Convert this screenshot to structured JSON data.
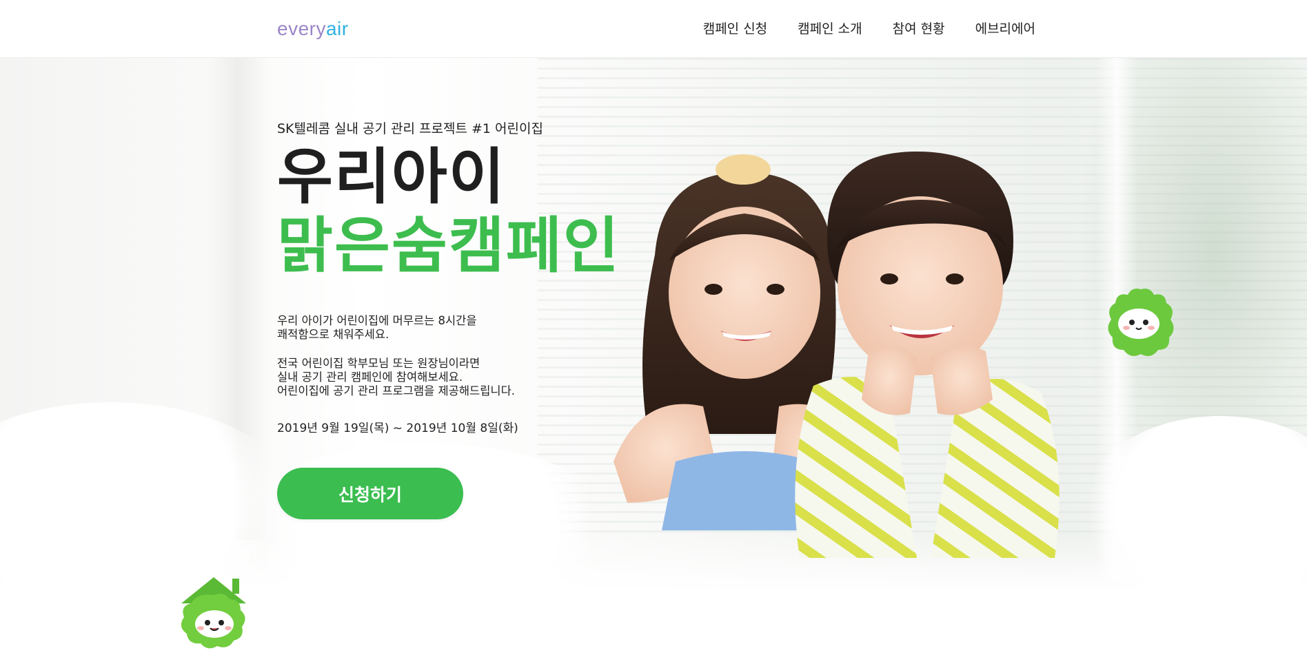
{
  "header": {
    "logo_every": "every",
    "logo_air": "air",
    "nav": [
      {
        "label": "캠페인 신청"
      },
      {
        "label": "캠페인 소개"
      },
      {
        "label": "참여 현황"
      },
      {
        "label": "에브리에어"
      }
    ]
  },
  "hero": {
    "eyebrow": "SK텔레콤 실내 공기 관리 프로젝트 #1 어린이집",
    "title_line1": "우리아이",
    "title_line2": "맑은숨캠페인",
    "desc1_line1": "우리 아이가 어린이집에 머무르는 8시간을",
    "desc1_line2": "쾌적함으로 채워주세요.",
    "desc2_line1": "전국 어린이집 학부모님 또는 원장님이라면",
    "desc2_line2": "실내 공기 관리 캠페인에 참여해보세요.",
    "desc2_line3": "어린이집에 공기 관리 프로그램을 제공해드립니다.",
    "period": "2019년 9월 19일(목) ~ 2019년 10월 8일(화)",
    "cta_label": "신청하기"
  },
  "colors": {
    "accent_green": "#3bbd50",
    "title_green": "#3dbd4e",
    "logo_purple": "#9b86c8",
    "logo_blue": "#2fb1e0"
  },
  "icons": {
    "mascot_right": "green-cloud-mascot-icon",
    "mascot_left": "green-house-mascot-icon"
  }
}
